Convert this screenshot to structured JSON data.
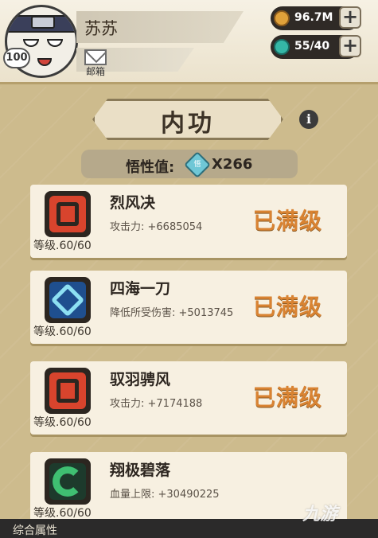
{
  "player": {
    "name": "苏苏",
    "level": "100",
    "mail_label": "邮箱"
  },
  "currencies": [
    {
      "icon": "coin-icon",
      "value": "96.7M",
      "color": "#e0a13a"
    },
    {
      "icon": "energy-orb-icon",
      "value": "55/40",
      "color": "#35b7a6"
    }
  ],
  "page": {
    "title": "内功",
    "info_icon": "i",
    "insight_label": "悟性值:",
    "insight_gem_icon": "悟",
    "insight_value": "X266"
  },
  "skills": [
    {
      "name": "烈风决",
      "stat": "攻击力: +6685054",
      "level": "等级.60/60",
      "status": "已满级",
      "icon": "fire-rune-icon"
    },
    {
      "name": "四海一刀",
      "stat": "降低所受伤害: +5013745",
      "level": "等级.60/60",
      "status": "已满级",
      "icon": "diamond-rune-icon"
    },
    {
      "name": "驭羽骋风",
      "stat": "攻击力: +7174188",
      "level": "等级.60/60",
      "status": "已满级",
      "icon": "fire-rune-icon"
    },
    {
      "name": "翔极碧落",
      "stat": "血量上限: +30490225",
      "level": "等级.60/60",
      "status": "",
      "icon": "swirl-rune-icon"
    }
  ],
  "bottom": {
    "label": "综合属性"
  },
  "watermark": "九游"
}
